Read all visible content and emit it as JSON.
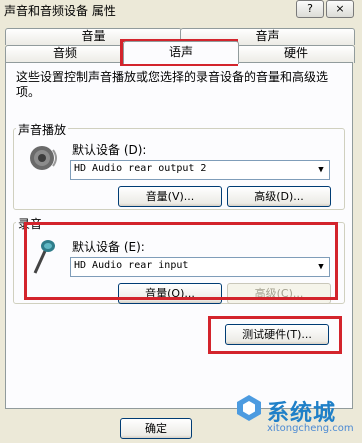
{
  "window": {
    "title": "声音和音频设备 属性",
    "help_label": "?",
    "close_label": "×"
  },
  "tabs": {
    "top_row": [
      {
        "label": "音量"
      },
      {
        "label": "音声"
      }
    ],
    "bottom_row": [
      {
        "label": "音频"
      },
      {
        "label": "语声",
        "selected": true
      },
      {
        "label": "硬件"
      }
    ]
  },
  "description": "这些设置控制声音播放或您选择的录音设备的音量和高级选项。",
  "playback": {
    "group_title": "声音播放",
    "icon": "speaker-icon",
    "device_label": "默认设备 (D):",
    "device_value": "HD Audio rear output 2",
    "volume_button": "音量(V)...",
    "advanced_button": "高级(D)..."
  },
  "recording": {
    "group_title": "录音",
    "icon": "microphone-icon",
    "device_label": "默认设备 (E):",
    "device_value": "HD Audio rear input",
    "volume_button": "音量(O)...",
    "advanced_button": "高级(C)..."
  },
  "test_hardware_button": "测试硬件(T)...",
  "footer": {
    "ok_button": "确定"
  },
  "watermark": {
    "main": "系统城",
    "sub": "xitongcheng.com"
  },
  "colors": {
    "highlight": "#d3242c",
    "window_bg": "#ece9d8",
    "panel_bg": "#fcfcfe"
  }
}
